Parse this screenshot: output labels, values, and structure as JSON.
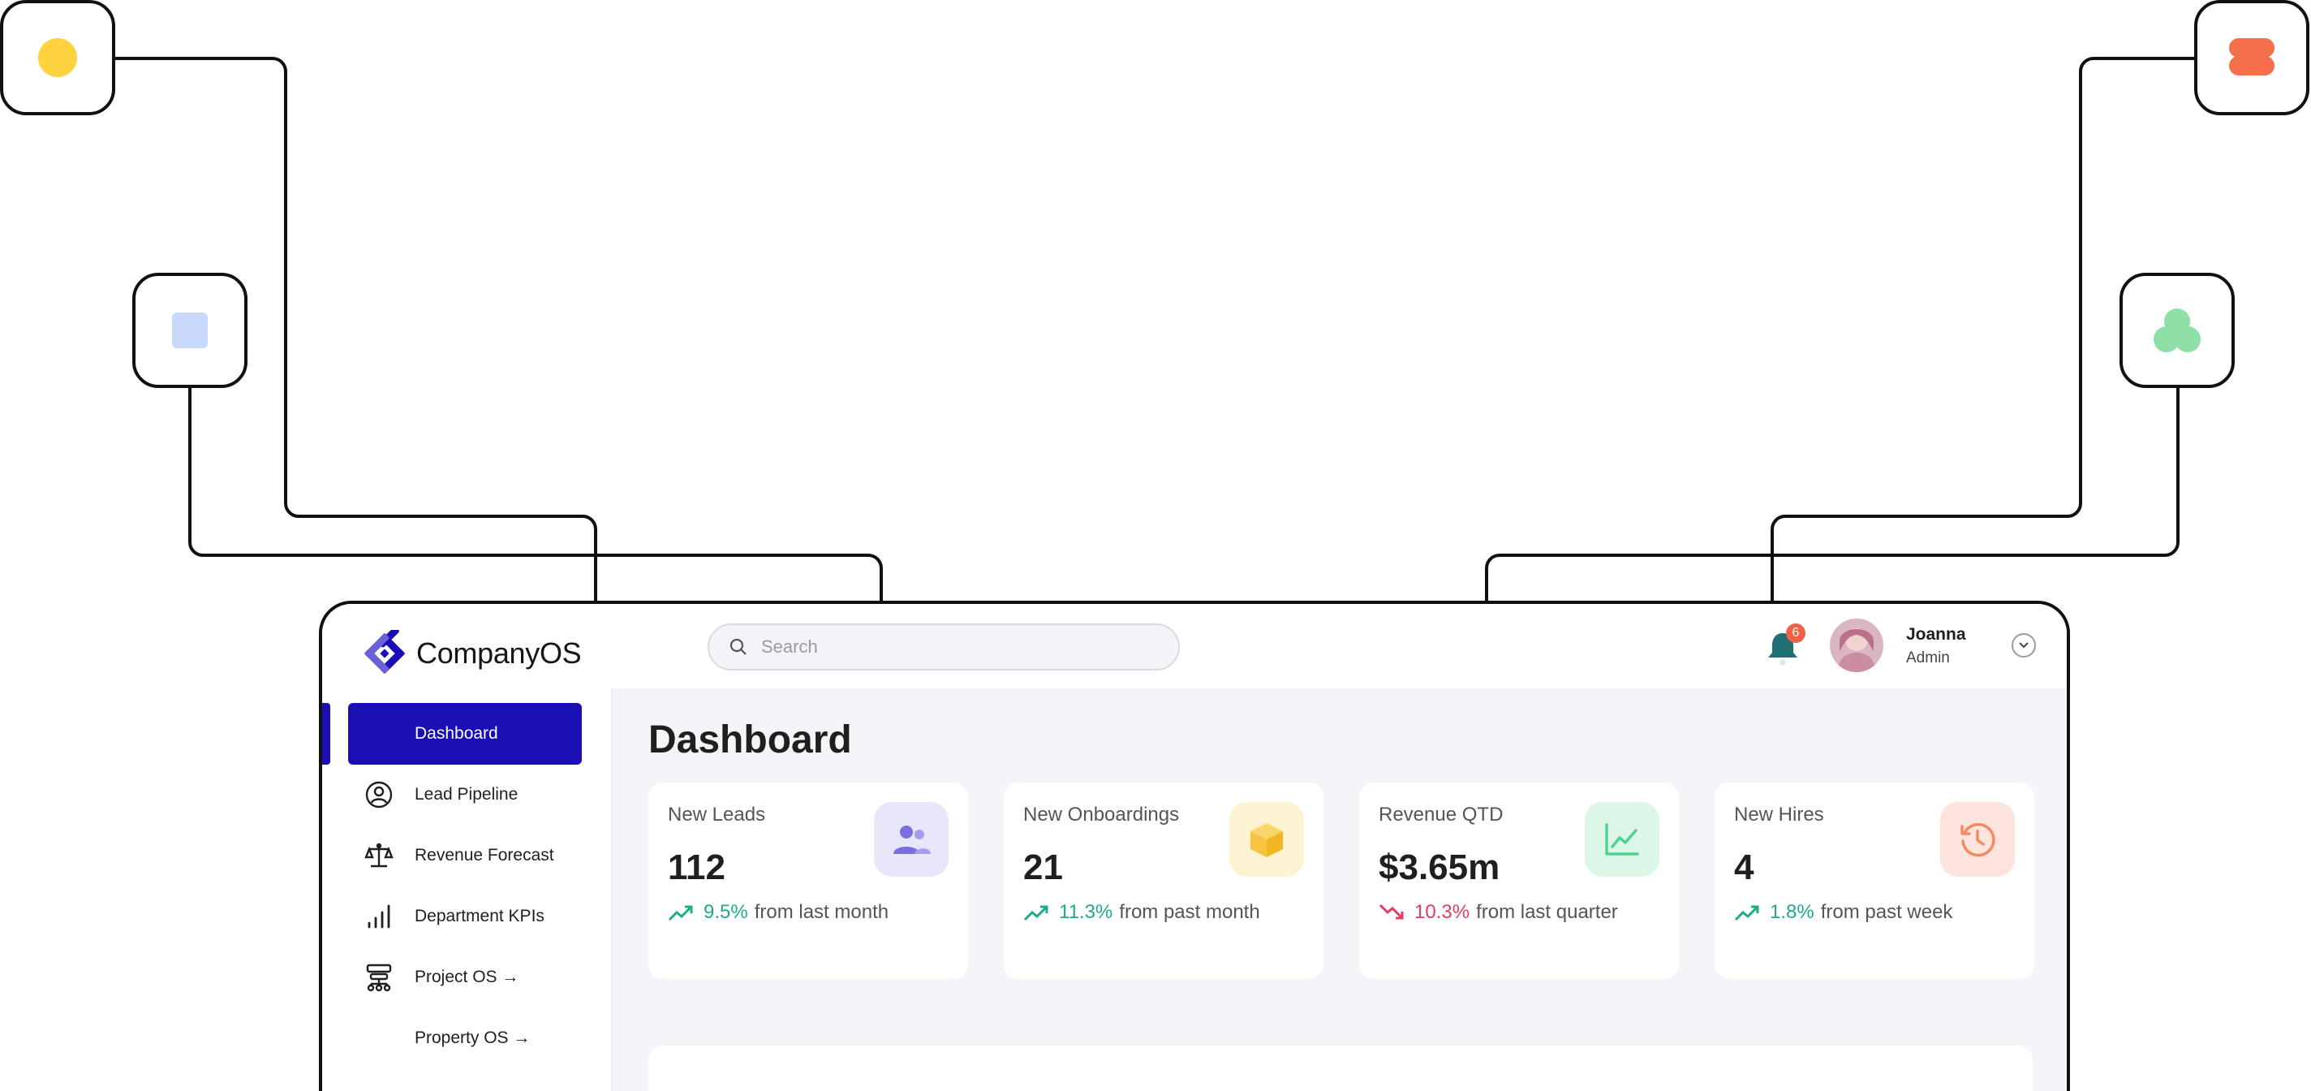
{
  "app": {
    "name": "CompanyOS"
  },
  "search": {
    "placeholder": "Search"
  },
  "notifications": {
    "count": "6"
  },
  "user": {
    "name": "Joanna",
    "role": "Admin"
  },
  "sidebar": {
    "items": [
      {
        "label": "Dashboard",
        "icon": "dashboard",
        "active": true
      },
      {
        "label": "Lead Pipeline",
        "icon": "user-circle-icon"
      },
      {
        "label": "Revenue Forecast",
        "icon": "scale-icon"
      },
      {
        "label": "Department KPIs",
        "icon": "signal-bars-icon"
      },
      {
        "label": "Project OS →",
        "icon": "org-chart-icon"
      },
      {
        "label": "Property OS →",
        "icon": ""
      }
    ]
  },
  "main": {
    "title": "Dashboard",
    "cards": [
      {
        "label": "New Leads",
        "value": "112",
        "trend_pct": "9.5%",
        "trend_text": "from last month",
        "direction": "up",
        "icon": "users-icon",
        "icon_bg": "#e8e6fb",
        "icon_color": "#7a6fe0"
      },
      {
        "label": "New Onboardings",
        "value": "21",
        "trend_pct": "11.3%",
        "trend_text": "from past month",
        "direction": "up",
        "icon": "box-icon",
        "icon_bg": "#fdf3d2",
        "icon_color": "#f6c440"
      },
      {
        "label": "Revenue QTD",
        "value": "$3.65m",
        "trend_pct": "10.3%",
        "trend_text": "from last quarter",
        "direction": "down",
        "icon": "line-chart-icon",
        "icon_bg": "#dcf7e8",
        "icon_color": "#4bd38f"
      },
      {
        "label": "New Hires",
        "value": "4",
        "trend_pct": "1.8%",
        "trend_text": "from past week",
        "direction": "up",
        "icon": "history-icon",
        "icon_bg": "#fde4dc",
        "icon_color": "#f4885f"
      }
    ]
  },
  "colors": {
    "brand": "#1a0fb4",
    "trend_up": "#1fab89",
    "trend_down": "#e53b5c",
    "notification": "#ef6247",
    "bell": "#1f6e74"
  },
  "tiles": [
    {
      "shape": "circle",
      "color": "#ffd23f"
    },
    {
      "shape": "pill-stack",
      "color": "#f56f4c"
    },
    {
      "shape": "square",
      "color": "#c8d9fb"
    },
    {
      "shape": "trefoil",
      "color": "#8ee0a6"
    }
  ]
}
